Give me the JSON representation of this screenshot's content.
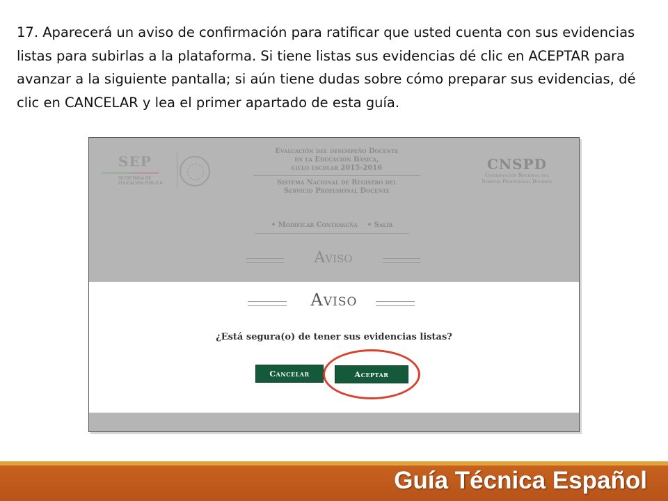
{
  "instruction": "17. Aparecerá un aviso de confirmación para ratificar que usted cuenta con sus evidencias listas para subirlas a la plataforma. Si tiene listas sus evidencias dé clic en ACEPTAR para avanzar a la siguiente pantalla; si aún tiene dudas sobre cómo preparar sus evidencias, dé clic en CANCELAR y lea el primer apartado de esta guía.",
  "screenshot": {
    "sep": {
      "name": "SEP",
      "subtitle_line1": "SECRETARÍA DE",
      "subtitle_line2": "EDUCACIÓN PÚBLICA"
    },
    "header_center": {
      "line1": "Evaluación del desempeño Docente",
      "line2": "en la Educación Básica,",
      "line3": "ciclo escolar 2015-2016",
      "line4": "Sistema Nacional de Registro del",
      "line5": "Servicio Profesional Docente"
    },
    "cnspd": {
      "name": "CNSPD",
      "subtitle_line1": "Coordinación Nacional del",
      "subtitle_line2": "Servicio Profesional Docente"
    },
    "menu": {
      "change_password": "• Modificar Contraseña",
      "exit": "• Salir"
    },
    "background_title": "Aviso",
    "modal": {
      "title": "Aviso",
      "question": "¿Está segura(o) de tener sus evidencias listas?",
      "cancel_label": "Cancelar",
      "accept_label": "Aceptar"
    },
    "highlight_color": "#d7412e",
    "button_color": "#14593a"
  },
  "footer": {
    "title": "Guía Técnica Español"
  },
  "colors": {
    "footer_orange": "#c6621f",
    "footer_stripe": "#e2a33a"
  }
}
